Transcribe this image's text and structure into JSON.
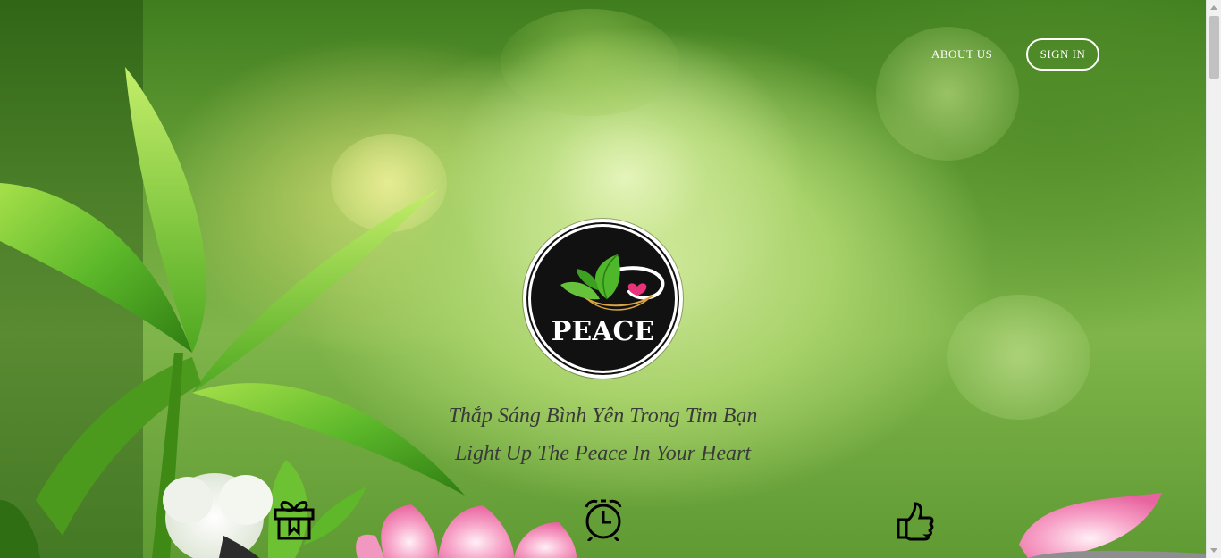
{
  "nav": {
    "about_label": "ABOUT US",
    "signin_label": "SIGN IN"
  },
  "logo": {
    "text": "PEACE"
  },
  "tagline": {
    "line1": "Thắp Sáng Bình Yên Trong Tim Bạn",
    "line2": "Light Up The Peace In Your Heart"
  },
  "features": {
    "icons": [
      "gift-icon",
      "alarm-clock-icon",
      "thumbs-up-icon"
    ]
  },
  "colors": {
    "nav_text": "#ffffff",
    "tagline_text": "#3a3a3a",
    "logo_bg": "#111111",
    "leaf_green": "#5cb82a",
    "lotus_pink": "#f07fb2"
  }
}
